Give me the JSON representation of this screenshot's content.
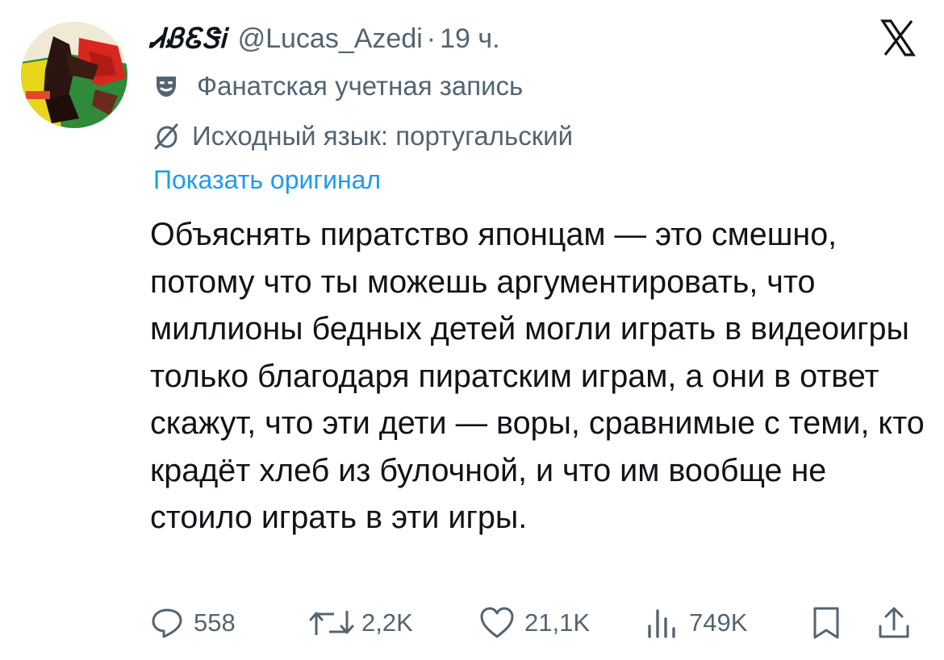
{
  "tweet": {
    "display_name": "ᏗᏰᏋᏕᎥ",
    "handle": "@Lucas_Azedi",
    "separator": "·",
    "time": "19 ч.",
    "fan_label": "Фанатская учетная запись",
    "language_label": "Исходный язык: португальский",
    "show_original": "Показать оригинал",
    "text": "Объяснять пиратство японцам — это смешно, потому что ты можешь аргументировать, что миллионы бедных детей могли играть в видеоигры только благодаря пиратским играм, а они в ответ скажут, что эти дети — воры, сравнимые с теми, кто крадёт хлеб из булочной, и что им вообще не стоило играть в эти игры."
  },
  "actions": {
    "replies": "558",
    "reposts": "2,2K",
    "likes": "21,1K",
    "views": "749K"
  },
  "icons": {
    "logo": "x-logo-icon",
    "fan": "theater-mask-icon",
    "translate": "translate-icon",
    "reply": "reply-icon",
    "repost": "repost-icon",
    "like": "heart-icon",
    "views": "views-chart-icon",
    "bookmark": "bookmark-icon",
    "share": "share-icon"
  },
  "colors": {
    "text": "#0f1419",
    "secondary": "#536471",
    "link": "#1d9bf0",
    "background": "#ffffff"
  }
}
